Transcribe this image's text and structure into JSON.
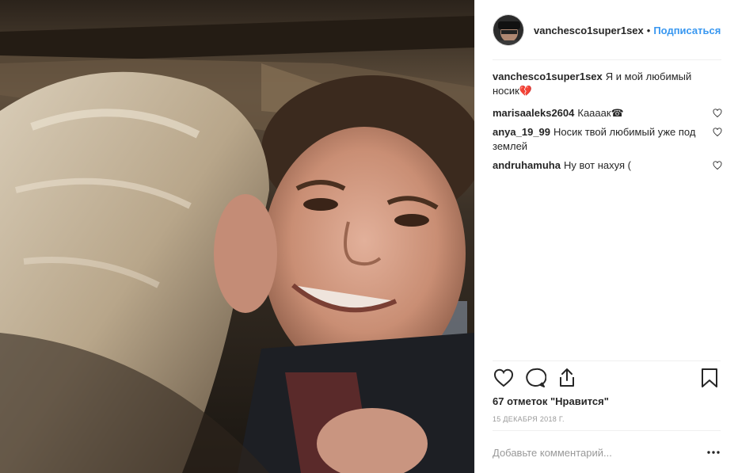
{
  "photo": {
    "alt_icon": "photo-image"
  },
  "header": {
    "username": "vanchesco1super1sex",
    "separator": "•",
    "follow_label": "Подписаться"
  },
  "caption": {
    "username": "vanchesco1super1sex",
    "text": "Я и мой любимый носик💔"
  },
  "comments": [
    {
      "username": "marisaaleks2604",
      "text": "Каааак☎"
    },
    {
      "username": "anya_19_99",
      "text": "Носик твой любимый уже под землей"
    },
    {
      "username": "andruhamuha",
      "text": "Ну вот нахуя ("
    }
  ],
  "actions": {
    "icons": [
      "heart-icon",
      "comment-icon",
      "share-icon",
      "bookmark-icon"
    ]
  },
  "likes_text": "67 отметок \"Нравится\"",
  "date_text": "15 декабря 2018 г.",
  "add_comment": {
    "placeholder": "Добавьте комментарий..."
  },
  "colors": {
    "link": "#3897f0",
    "text": "#262626",
    "muted": "#999999",
    "divider": "#efefef"
  }
}
